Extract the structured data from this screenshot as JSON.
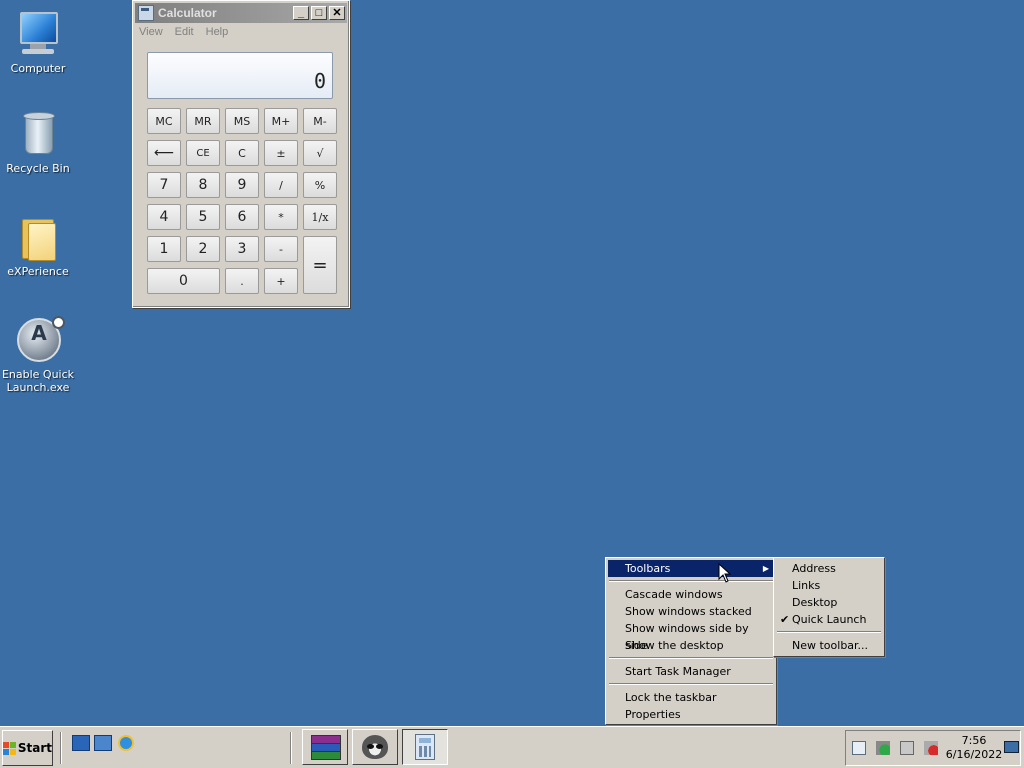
{
  "desktop": {
    "icons": [
      {
        "label": "Computer",
        "icon": "computer-icon"
      },
      {
        "label": "Recycle Bin",
        "icon": "recycle-bin-icon"
      },
      {
        "label": "eXPerience",
        "icon": "folder-icon"
      },
      {
        "label": "Enable Quick Launch.exe",
        "icon": "app-icon"
      }
    ]
  },
  "calculator": {
    "title": "Calculator",
    "menu": [
      "View",
      "Edit",
      "Help"
    ],
    "display": "0",
    "window_buttons": {
      "minimize": "_",
      "maximize": "□",
      "close": "✕"
    },
    "keys": {
      "mc": "MC",
      "mr": "MR",
      "ms": "MS",
      "mplus": "M+",
      "mminus": "M-",
      "backspace": "⟵",
      "ce": "CE",
      "c": "C",
      "negate": "±",
      "sqrt": "√",
      "d7": "7",
      "d8": "8",
      "d9": "9",
      "divide": "/",
      "percent": "%",
      "d4": "4",
      "d5": "5",
      "d6": "6",
      "multiply": "*",
      "reciprocal": "1/x",
      "d1": "1",
      "d2": "2",
      "d3": "3",
      "subtract": "-",
      "equals": "=",
      "d0": "0",
      "decimal": ".",
      "add": "+"
    }
  },
  "context_menu": {
    "items": [
      {
        "label": "Toolbars",
        "has_submenu": true,
        "selected": true
      },
      {
        "label": "Cascade windows"
      },
      {
        "label": "Show windows stacked"
      },
      {
        "label": "Show windows side by side"
      },
      {
        "label": "Show the desktop"
      },
      {
        "label": "Start Task Manager"
      },
      {
        "label": "Lock the taskbar"
      },
      {
        "label": "Properties"
      }
    ],
    "submenu_arrow": "▶"
  },
  "toolbars_submenu": {
    "items": [
      {
        "label": "Address",
        "checked": false
      },
      {
        "label": "Links",
        "checked": false
      },
      {
        "label": "Desktop",
        "checked": false
      },
      {
        "label": "Quick Launch",
        "checked": true
      },
      {
        "label": "New toolbar..."
      }
    ],
    "check_glyph": "✔"
  },
  "taskbar": {
    "start_label": "Start",
    "quick_launch": [
      "show-desktop-icon",
      "switch-windows-icon",
      "internet-explorer-icon"
    ],
    "tasks": [
      "winrar-icon",
      "raccoon-app-icon",
      "calculator-icon"
    ],
    "clock": {
      "time": "7:56",
      "date": "6/16/2022"
    }
  },
  "colors": {
    "desktop_bg": "#3a6ea5",
    "menu_highlight": "#0a246a",
    "chrome_gray": "#d4d0c8"
  }
}
